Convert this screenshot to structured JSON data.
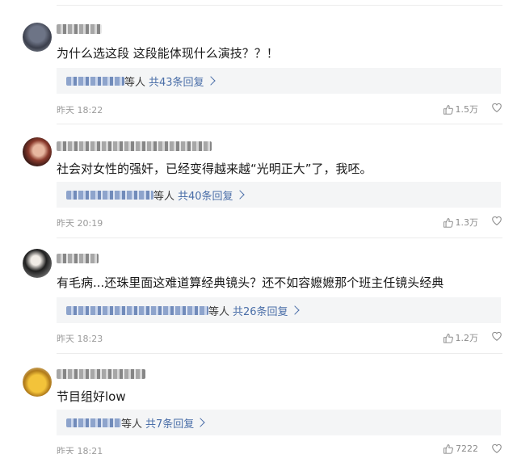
{
  "comments": [
    {
      "text": "为什么选这段 这段能体现什么演技？？！",
      "reply_suffix": "等人",
      "reply_count": "共43条回复",
      "time": "昨天 18:22",
      "likes": "1.5万"
    },
    {
      "text": "社会对女性的强奸，已经变得越来越“光明正大”了，我呸。",
      "reply_suffix": "等人",
      "reply_count": "共40条回复",
      "time": "昨天 20:19",
      "likes": "1.3万"
    },
    {
      "text": "有毛病...还珠里面这难道算经典镜头？还不如容嬷嬷那个班主任镜头经典",
      "reply_suffix": "等人",
      "reply_count": "共26条回复",
      "time": "昨天 18:23",
      "likes": "1.2万"
    },
    {
      "text": "节目组好low",
      "reply_suffix": "等人",
      "reply_count": "共7条回复",
      "time": "昨天 18:21",
      "likes": "7222"
    }
  ],
  "colors": {
    "link_blue": "#4a6ea8",
    "reply_bg": "#f4f5f6",
    "meta_gray": "#9a9a9a"
  },
  "icons": [
    "avatar",
    "thumbs-up-icon",
    "heart-icon",
    "chevron-right-icon"
  ]
}
